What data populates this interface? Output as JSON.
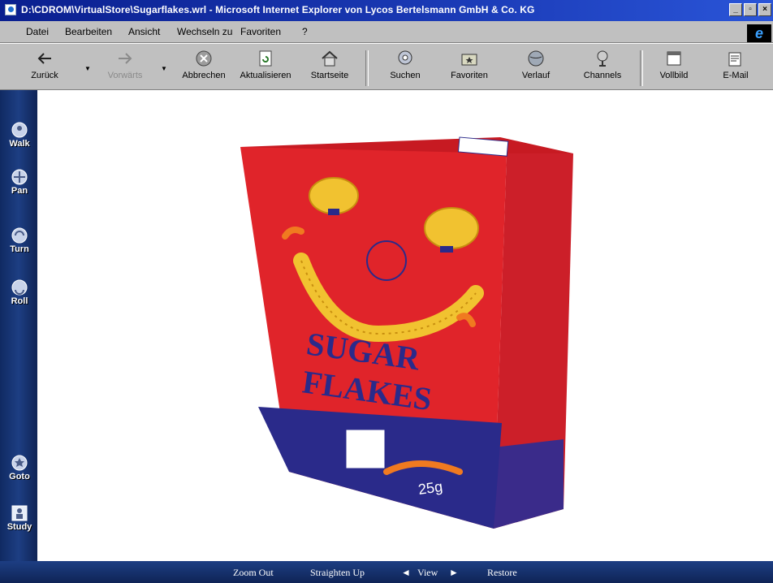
{
  "window": {
    "title": "D:\\CDROM\\VirtualStore\\Sugarflakes.wrl - Microsoft Internet Explorer von Lycos Bertelsmann GmbH & Co. KG"
  },
  "menu": {
    "items": [
      "Datei",
      "Bearbeiten",
      "Ansicht",
      "Wechseln zu",
      "Favoriten",
      "?"
    ]
  },
  "toolbar": {
    "back": "Zurück",
    "forward": "Vorwärts",
    "stop": "Abbrechen",
    "refresh": "Aktualisieren",
    "home": "Startseite",
    "search": "Suchen",
    "favorites": "Favoriten",
    "history": "Verlauf",
    "channels": "Channels",
    "fullscreen": "Vollbild",
    "mail": "E-Mail"
  },
  "nav3d": {
    "walk": "Walk",
    "pan": "Pan",
    "turn": "Turn",
    "roll": "Roll",
    "goto": "Goto",
    "study": "Study"
  },
  "bottom": {
    "zoom_out": "Zoom Out",
    "straighten": "Straighten Up",
    "view": "View",
    "restore": "Restore"
  },
  "box": {
    "brand_line1": "SUGAR",
    "brand_line2": "FLAKES",
    "weight": "25g",
    "colors": {
      "box_red": "#e0242a",
      "box_blue": "#2a2a8a",
      "flake": "#f1c230"
    }
  }
}
